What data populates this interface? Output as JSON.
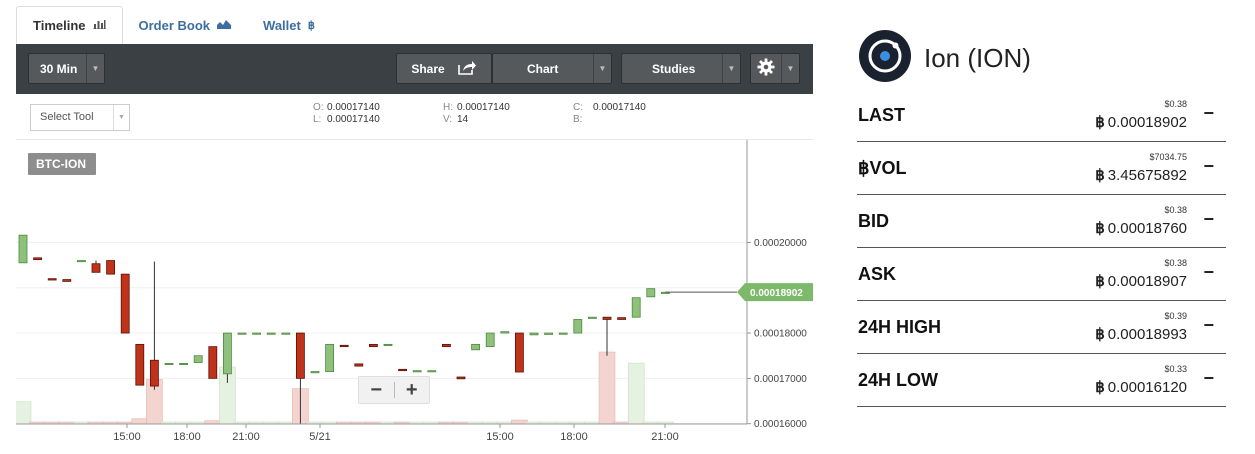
{
  "tabs": [
    {
      "label": "Timeline",
      "icon": "bar-chart-icon"
    },
    {
      "label": "Order Book",
      "icon": "area-chart-icon"
    },
    {
      "label": "Wallet",
      "icon": "bitcoin-icon"
    }
  ],
  "toolbar": {
    "interval": "30 Min",
    "share": "Share",
    "chart": "Chart",
    "studies": "Studies",
    "settings_icon": "gear-icon"
  },
  "infobar": {
    "select_tool": "Select Tool",
    "o_key": "O:",
    "o_val": "0.00017140",
    "l_key": "L:",
    "l_val": "0.00017140",
    "h_key": "H:",
    "h_val": "0.00017140",
    "v_key": "V:",
    "v_val": "14",
    "c_key": "C:",
    "c_val": "0.00017140",
    "b_key": "B:",
    "b_val": ""
  },
  "zoom": {
    "minus": "−",
    "plus": "+"
  },
  "chart_data": {
    "type": "candlestick",
    "symbol_label": "BTC-ION",
    "last_price_label": "0.00018902",
    "y_ticks": [
      "0.00020000",
      "0.00019000",
      "0.00018000",
      "0.00017000",
      "0.00016000"
    ],
    "ylim": [
      0.00015993,
      0.0002226
    ],
    "x_ticks": [
      "15:00",
      "18:00",
      "21:00",
      "5/21",
      "15:00",
      "18:00",
      "21:00"
    ],
    "colors": {
      "up": "#8fc17c",
      "down": "#c0321a",
      "up_border": "#4b8a3e",
      "down_border": "#5a1208",
      "vol_up": "#e6f2e1",
      "vol_down": "#f4d4cf",
      "last_tag": "#7cb96b"
    },
    "candles": [
      {
        "o": 0.0001955,
        "h": 0.0002016,
        "l": 0.0001955,
        "c": 0.0002016,
        "v": 34
      },
      {
        "o": 0.0001966,
        "h": 0.0001966,
        "l": 0.0001962,
        "c": 0.0001962,
        "v": 0
      },
      {
        "o": 0.000192,
        "h": 0.000192,
        "l": 0.0001917,
        "c": 0.0001917,
        "v": 0
      },
      {
        "o": 0.0001918,
        "h": 0.0001918,
        "l": 0.0001914,
        "c": 0.0001914,
        "v": 0
      },
      {
        "o": 0.000196,
        "h": 0.000196,
        "l": 0.000196,
        "c": 0.000196,
        "v": 0
      },
      {
        "o": 0.0001953,
        "h": 0.000196,
        "l": 0.0001934,
        "c": 0.0001934,
        "v": 0
      },
      {
        "o": 0.000196,
        "h": 0.000196,
        "l": 0.000193,
        "c": 0.000193,
        "v": 0
      },
      {
        "o": 0.000193,
        "h": 0.000193,
        "l": 0.00018,
        "c": 0.00018,
        "v": 2
      },
      {
        "o": 0.0001775,
        "h": 0.0001775,
        "l": 0.0001685,
        "c": 0.0001685,
        "v": 8
      },
      {
        "o": 0.000174,
        "h": 0.0001958,
        "l": 0.0001675,
        "c": 0.0001683,
        "v": 68
      },
      {
        "o": 0.0001733,
        "h": 0.0001733,
        "l": 0.0001733,
        "c": 0.0001733,
        "v": 0
      },
      {
        "o": 0.0001733,
        "h": 0.0001733,
        "l": 0.0001733,
        "c": 0.0001733,
        "v": 0
      },
      {
        "o": 0.0001735,
        "h": 0.000175,
        "l": 0.0001735,
        "c": 0.000175,
        "v": 2
      },
      {
        "o": 0.000177,
        "h": 0.000177,
        "l": 0.00017,
        "c": 0.00017,
        "v": 5
      },
      {
        "o": 0.000171,
        "h": 0.00018,
        "l": 0.000169,
        "c": 0.00018,
        "v": 87
      },
      {
        "o": 0.00018,
        "h": 0.00018,
        "l": 0.00018,
        "c": 0.00018,
        "v": 0
      },
      {
        "o": 0.00018,
        "h": 0.00018,
        "l": 0.00018,
        "c": 0.00018,
        "v": 0
      },
      {
        "o": 0.00018,
        "h": 0.00018,
        "l": 0.00018,
        "c": 0.00018,
        "v": 0
      },
      {
        "o": 0.00018,
        "h": 0.00018,
        "l": 0.00018,
        "c": 0.00018,
        "v": 0
      },
      {
        "o": 0.00018,
        "h": 0.00018,
        "l": 0.00016,
        "c": 0.00017,
        "v": 54
      },
      {
        "o": 0.0001715,
        "h": 0.0001715,
        "l": 0.0001715,
        "c": 0.0001715,
        "v": 0
      },
      {
        "o": 0.0001715,
        "h": 0.0001775,
        "l": 0.0001715,
        "c": 0.0001775,
        "v": 0
      },
      {
        "o": 0.0001773,
        "h": 0.0001773,
        "l": 0.000177,
        "c": 0.000177,
        "v": 0
      },
      {
        "o": 0.0001732,
        "h": 0.0001732,
        "l": 0.0001727,
        "c": 0.0001727,
        "v": 0
      },
      {
        "o": 0.0001775,
        "h": 0.0001775,
        "l": 0.000177,
        "c": 0.000177,
        "v": 0
      },
      {
        "o": 0.0001775,
        "h": 0.0001775,
        "l": 0.0001775,
        "c": 0.0001775,
        "v": 0
      },
      {
        "o": 0.000172,
        "h": 0.000172,
        "l": 0.0001717,
        "c": 0.0001717,
        "v": 0
      },
      {
        "o": 0.0001717,
        "h": 0.0001717,
        "l": 0.0001717,
        "c": 0.0001717,
        "v": 0
      },
      {
        "o": 0.0001717,
        "h": 0.0001717,
        "l": 0.0001717,
        "c": 0.0001717,
        "v": 0
      },
      {
        "o": 0.0001775,
        "h": 0.0001775,
        "l": 0.000177,
        "c": 0.000177,
        "v": 0
      },
      {
        "o": 0.0001703,
        "h": 0.0001703,
        "l": 0.0001699,
        "c": 0.0001699,
        "v": 0
      },
      {
        "o": 0.0001763,
        "h": 0.0001775,
        "l": 0.0001763,
        "c": 0.0001775,
        "v": 0
      },
      {
        "o": 0.000177,
        "h": 0.00018,
        "l": 0.000177,
        "c": 0.00018,
        "v": 0
      },
      {
        "o": 0.00018,
        "h": 0.0001803,
        "l": 0.00018,
        "c": 0.0001803,
        "v": 0
      },
      {
        "o": 0.00018,
        "h": 0.00018,
        "l": 0.0001714,
        "c": 0.0001714,
        "v": 6
      },
      {
        "o": 0.0001796,
        "h": 0.00018,
        "l": 0.0001796,
        "c": 0.00018,
        "v": 0
      },
      {
        "o": 0.0001797,
        "h": 0.00018,
        "l": 0.0001797,
        "c": 0.00018,
        "v": 0
      },
      {
        "o": 0.00018,
        "h": 0.00018,
        "l": 0.00018,
        "c": 0.00018,
        "v": 0
      },
      {
        "o": 0.00018,
        "h": 0.000183,
        "l": 0.00018,
        "c": 0.000183,
        "v": 0
      },
      {
        "o": 0.0001835,
        "h": 0.0001835,
        "l": 0.0001835,
        "c": 0.0001835,
        "v": 0
      },
      {
        "o": 0.0001835,
        "h": 0.0001835,
        "l": 0.000175,
        "c": 0.000183,
        "v": 110
      },
      {
        "o": 0.0001834,
        "h": 0.0001834,
        "l": 0.000183,
        "c": 0.000183,
        "v": 0
      },
      {
        "o": 0.0001835,
        "h": 0.0001878,
        "l": 0.0001835,
        "c": 0.0001878,
        "v": 93
      },
      {
        "o": 0.000188,
        "h": 0.0001898,
        "l": 0.000188,
        "c": 0.0001898,
        "v": 0
      },
      {
        "o": 0.000189,
        "h": 0.000189,
        "l": 0.000189,
        "c": 0.000189,
        "v": 0
      }
    ],
    "visible_candles": [
      0,
      1,
      2,
      3,
      4,
      5,
      6,
      7,
      8,
      9,
      10,
      11,
      12,
      13,
      14,
      15,
      16,
      17,
      18,
      19,
      20,
      21,
      22,
      23,
      24,
      25,
      26,
      27,
      28,
      29,
      30,
      31,
      32,
      33,
      34,
      35,
      36,
      37,
      38,
      39,
      40,
      41,
      42,
      43,
      44
    ]
  },
  "coin": {
    "name": "Ion (ION)",
    "logo_icon": "ion-logo-icon"
  },
  "stats": [
    {
      "label": "LAST",
      "usd": "$0.38",
      "btc": "0.00018902",
      "btc_symbol": "฿",
      "toggle": "−"
    },
    {
      "label": "฿VOL",
      "usd": "$7034.75",
      "btc": "3.45675892",
      "btc_symbol": "฿",
      "toggle": "−"
    },
    {
      "label": "BID",
      "usd": "$0.38",
      "btc": "0.00018760",
      "btc_symbol": "฿",
      "toggle": "−"
    },
    {
      "label": "ASK",
      "usd": "$0.38",
      "btc": "0.00018907",
      "btc_symbol": "฿",
      "toggle": "−"
    },
    {
      "label": "24H HIGH",
      "usd": "$0.39",
      "btc": "0.00018993",
      "btc_symbol": "฿",
      "toggle": "−"
    },
    {
      "label": "24H LOW",
      "usd": "$0.33",
      "btc": "0.00016120",
      "btc_symbol": "฿",
      "toggle": "−"
    }
  ]
}
